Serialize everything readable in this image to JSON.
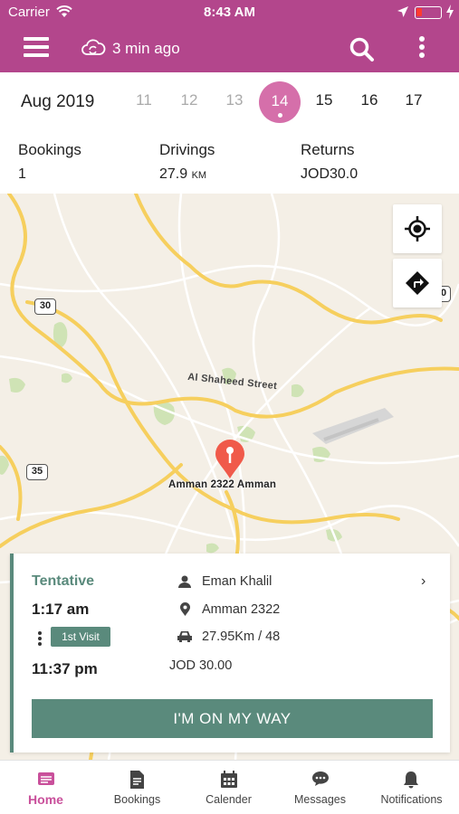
{
  "status_bar": {
    "carrier": "Carrier",
    "time": "8:43 AM",
    "battery_color": "#ff3b30"
  },
  "app_bar": {
    "background": "#b3468c",
    "sync_text": "3 min ago",
    "icons": [
      "menu-icon",
      "cloud-sync-icon",
      "search-icon",
      "more-vertical-icon"
    ]
  },
  "date_strip": {
    "month": "Aug 2019",
    "days": [
      {
        "label": "11",
        "state": "past"
      },
      {
        "label": "12",
        "state": "past"
      },
      {
        "label": "13",
        "state": "past"
      },
      {
        "label": "14",
        "state": "selected"
      },
      {
        "label": "15",
        "state": "future"
      },
      {
        "label": "16",
        "state": "future"
      },
      {
        "label": "17",
        "state": "future"
      }
    ],
    "selected_color": "#d56faa"
  },
  "stats": {
    "bookings": {
      "title": "Bookings",
      "value": "1"
    },
    "drivings": {
      "title": "Drivings",
      "value": "27.9",
      "unit": "KM"
    },
    "returns": {
      "title": "Returns",
      "value": "JOD30.0"
    }
  },
  "map": {
    "street_label": "Al Shaheed Street",
    "pin_label": "Amman 2322 Amman",
    "road_shields": [
      "30",
      "35",
      "30"
    ],
    "controls": [
      "my-location-icon",
      "directions-icon"
    ],
    "pin_color": "#f05a4a"
  },
  "booking_card": {
    "status": "Tentative",
    "start_time": "1:17 am",
    "visit_badge": "1st Visit",
    "end_time": "11:37 pm",
    "customer": "Eman Khalil",
    "location": "Amman  2322",
    "distance": "27.95Km / 48",
    "amount": "JOD 30.00",
    "action_label": "I'M ON MY WAY",
    "accent_color": "#5a8a7c"
  },
  "bottom_nav": {
    "items": [
      {
        "label": "Home",
        "icon": "home-icon",
        "active": true
      },
      {
        "label": "Bookings",
        "icon": "bookings-icon",
        "active": false
      },
      {
        "label": "Calender",
        "icon": "calendar-icon",
        "active": false
      },
      {
        "label": "Messages",
        "icon": "messages-icon",
        "active": false
      },
      {
        "label": "Notifications",
        "icon": "notifications-icon",
        "active": false
      }
    ],
    "active_color": "#c9509b"
  }
}
